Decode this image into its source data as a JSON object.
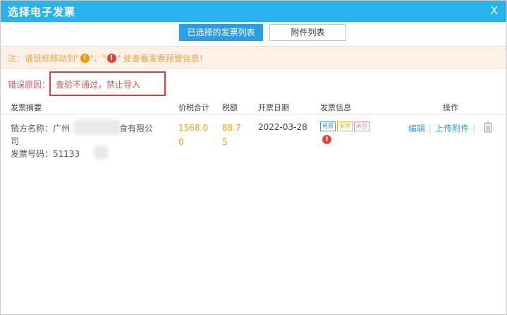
{
  "dialog": {
    "title": "选择电子发票",
    "close_label": "X"
  },
  "tabs": [
    {
      "label": "已选择的发票列表",
      "active": true
    },
    {
      "label": "附件列表",
      "active": false
    }
  ],
  "notice": {
    "prefix": "注：请鼠标移动到\"",
    "mid": "\"、\"",
    "suffix": "\" 处查看发票预警信息!",
    "dot1": "!",
    "dot2": "!"
  },
  "error": {
    "label": "错误原因：",
    "message": "查验不通过，禁止导入"
  },
  "table": {
    "headers": [
      "发票摘要",
      "价税合计",
      "税额",
      "开票日期",
      "发票信息",
      "操作"
    ],
    "rows": [
      {
        "seller": "销方名称：广州",
        "seller_tail": "饮食有限公",
        "seller_line2": "司",
        "invoice_no": "发票号码：51133",
        "amount": "1568.00",
        "tax": "88.75",
        "date": "2022-03-28",
        "tags": [
          "电票",
          "未用",
          "未验"
        ],
        "alert": "!",
        "ops": {
          "edit": "编辑",
          "upload": "上传附件"
        }
      }
    ]
  },
  "colors": {
    "titlebar": "#29b3ec",
    "tab_active": "#2f9de4",
    "notice_text": "#f1a33a",
    "error_border": "#e53b3b",
    "amount": "#e8a21b"
  }
}
